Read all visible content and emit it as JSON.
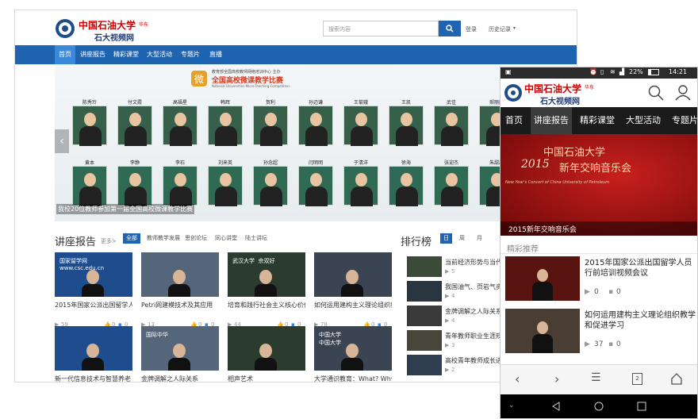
{
  "desktop": {
    "logo": {
      "name": "中国石油大学",
      "badge": "华东",
      "sub": "石大视频网"
    },
    "search": {
      "placeholder": "搜索内容",
      "login": "登录",
      "history": "历史记录"
    },
    "nav": [
      "首页",
      "讲座报告",
      "精彩课堂",
      "大型活动",
      "专题片",
      "直播"
    ],
    "banner": {
      "org": "教育部全国高校教师网络培训中心  主办",
      "title": "全国高校微课教学比赛",
      "en": "National Universities Micro-Teaching Competition",
      "row1": [
        "陈秀玲",
        "付文霞",
        "高福星",
        "韩辉",
        "贺利",
        "孙迈谦",
        "王菊娥",
        "王凯",
        "武佳",
        "郝丽丽"
      ],
      "row2": [
        "黄本",
        "李静",
        "李石",
        "刘来英",
        "孙念超",
        "闫明明",
        "于清洋",
        "徐海",
        "张迎杰",
        "朱甜甜"
      ],
      "caption": "我校20位教师参加第一届全国高校微课教学比赛"
    },
    "lecture": {
      "title": "讲座报告",
      "more": "更多>",
      "tabs": [
        "全部",
        "教师教学发展",
        "思创论坛",
        "同心讲堂",
        "陆士讲坛"
      ],
      "row1": [
        {
          "title": "2015年国家公派出国留学人员行前",
          "views": "59",
          "likes": "0",
          "comments": "0",
          "thumb_text": "国家留学网\nwww.csc.edu.cn"
        },
        {
          "title": "Petri网建模技术及其应用",
          "views": "13",
          "likes": "0",
          "comments": "0",
          "thumb_text": ""
        },
        {
          "title": "培育和践行社会主义核心价值观",
          "views": "44",
          "likes": "0",
          "comments": "0",
          "thumb_text": "武汉大学  佘双好"
        },
        {
          "title": "如何运用建构主义理论组织教学和",
          "views": "78",
          "likes": "0",
          "comments": "0",
          "thumb_text": ""
        }
      ],
      "row2": [
        {
          "title": "新一代信息技术与智慧养老",
          "thumb_text": ""
        },
        {
          "title": "金牌调解之人际关系",
          "thumb_text": "国际中华"
        },
        {
          "title": "相声艺术",
          "thumb_text": ""
        },
        {
          "title": "大学通识教育：What? Why?",
          "thumb_text": "中国大学\n中国大学"
        }
      ]
    },
    "rank": {
      "title": "排行榜",
      "tabs": [
        "日",
        "周",
        "月"
      ],
      "items": [
        {
          "title": "当前经济形势与当代大学",
          "count": "5"
        },
        {
          "title": "我国油气、页岩气资源现",
          "count": "4"
        },
        {
          "title": "金牌调解之人际关系",
          "count": "4"
        },
        {
          "title": "青年教师职业生涯规划",
          "count": "3"
        },
        {
          "title": "高校青年教师成长进行",
          "count": "2"
        }
      ]
    }
  },
  "phone": {
    "status": {
      "battery": "22%",
      "time": "14:21"
    },
    "logo": {
      "name": "中国石油大学",
      "badge": "华东",
      "sub": "石大视频网"
    },
    "nav": [
      "首页",
      "讲座报告",
      "精彩课堂",
      "大型活动",
      "专题片"
    ],
    "banner": {
      "line1": "中国石油大学",
      "year": "2015",
      "line2": "新年交响音乐会",
      "en": "New Year's Concert of China University of Petroleum",
      "caption": "2015新年交响音乐会"
    },
    "section": "精彩推荐",
    "items": [
      {
        "title": "2015年国家公派出国留学人员行前培训视频会议",
        "views": "0",
        "comments": "0"
      },
      {
        "title": "如何运用建构主义理论组织教学和促进学习",
        "views": "37",
        "comments": "0"
      }
    ],
    "bottom": {
      "tabs": "2"
    }
  },
  "colors": {
    "brand_blue": "#1f64b0",
    "logo_red": "#cc0000",
    "banner_red": "#8e0d0d"
  }
}
